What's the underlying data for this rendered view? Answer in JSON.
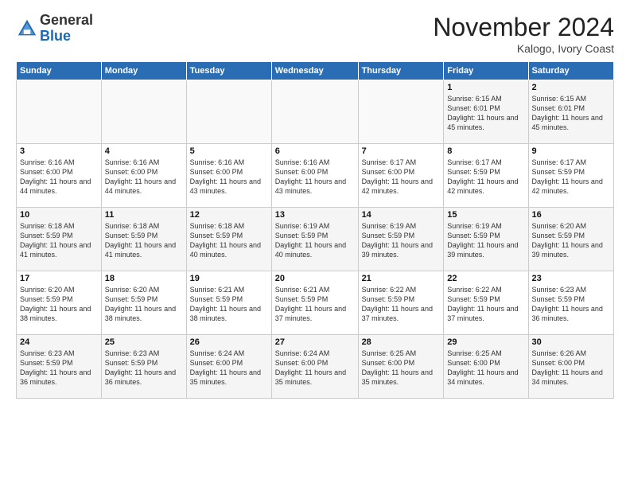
{
  "logo": {
    "general": "General",
    "blue": "Blue"
  },
  "header": {
    "title": "November 2024",
    "location": "Kalogo, Ivory Coast"
  },
  "weekdays": [
    "Sunday",
    "Monday",
    "Tuesday",
    "Wednesday",
    "Thursday",
    "Friday",
    "Saturday"
  ],
  "weeks": [
    [
      {
        "day": "",
        "info": ""
      },
      {
        "day": "",
        "info": ""
      },
      {
        "day": "",
        "info": ""
      },
      {
        "day": "",
        "info": ""
      },
      {
        "day": "",
        "info": ""
      },
      {
        "day": "1",
        "info": "Sunrise: 6:15 AM\nSunset: 6:01 PM\nDaylight: 11 hours and 45 minutes."
      },
      {
        "day": "2",
        "info": "Sunrise: 6:15 AM\nSunset: 6:01 PM\nDaylight: 11 hours and 45 minutes."
      }
    ],
    [
      {
        "day": "3",
        "info": "Sunrise: 6:16 AM\nSunset: 6:00 PM\nDaylight: 11 hours and 44 minutes."
      },
      {
        "day": "4",
        "info": "Sunrise: 6:16 AM\nSunset: 6:00 PM\nDaylight: 11 hours and 44 minutes."
      },
      {
        "day": "5",
        "info": "Sunrise: 6:16 AM\nSunset: 6:00 PM\nDaylight: 11 hours and 43 minutes."
      },
      {
        "day": "6",
        "info": "Sunrise: 6:16 AM\nSunset: 6:00 PM\nDaylight: 11 hours and 43 minutes."
      },
      {
        "day": "7",
        "info": "Sunrise: 6:17 AM\nSunset: 6:00 PM\nDaylight: 11 hours and 42 minutes."
      },
      {
        "day": "8",
        "info": "Sunrise: 6:17 AM\nSunset: 5:59 PM\nDaylight: 11 hours and 42 minutes."
      },
      {
        "day": "9",
        "info": "Sunrise: 6:17 AM\nSunset: 5:59 PM\nDaylight: 11 hours and 42 minutes."
      }
    ],
    [
      {
        "day": "10",
        "info": "Sunrise: 6:18 AM\nSunset: 5:59 PM\nDaylight: 11 hours and 41 minutes."
      },
      {
        "day": "11",
        "info": "Sunrise: 6:18 AM\nSunset: 5:59 PM\nDaylight: 11 hours and 41 minutes."
      },
      {
        "day": "12",
        "info": "Sunrise: 6:18 AM\nSunset: 5:59 PM\nDaylight: 11 hours and 40 minutes."
      },
      {
        "day": "13",
        "info": "Sunrise: 6:19 AM\nSunset: 5:59 PM\nDaylight: 11 hours and 40 minutes."
      },
      {
        "day": "14",
        "info": "Sunrise: 6:19 AM\nSunset: 5:59 PM\nDaylight: 11 hours and 39 minutes."
      },
      {
        "day": "15",
        "info": "Sunrise: 6:19 AM\nSunset: 5:59 PM\nDaylight: 11 hours and 39 minutes."
      },
      {
        "day": "16",
        "info": "Sunrise: 6:20 AM\nSunset: 5:59 PM\nDaylight: 11 hours and 39 minutes."
      }
    ],
    [
      {
        "day": "17",
        "info": "Sunrise: 6:20 AM\nSunset: 5:59 PM\nDaylight: 11 hours and 38 minutes."
      },
      {
        "day": "18",
        "info": "Sunrise: 6:20 AM\nSunset: 5:59 PM\nDaylight: 11 hours and 38 minutes."
      },
      {
        "day": "19",
        "info": "Sunrise: 6:21 AM\nSunset: 5:59 PM\nDaylight: 11 hours and 38 minutes."
      },
      {
        "day": "20",
        "info": "Sunrise: 6:21 AM\nSunset: 5:59 PM\nDaylight: 11 hours and 37 minutes."
      },
      {
        "day": "21",
        "info": "Sunrise: 6:22 AM\nSunset: 5:59 PM\nDaylight: 11 hours and 37 minutes."
      },
      {
        "day": "22",
        "info": "Sunrise: 6:22 AM\nSunset: 5:59 PM\nDaylight: 11 hours and 37 minutes."
      },
      {
        "day": "23",
        "info": "Sunrise: 6:23 AM\nSunset: 5:59 PM\nDaylight: 11 hours and 36 minutes."
      }
    ],
    [
      {
        "day": "24",
        "info": "Sunrise: 6:23 AM\nSunset: 5:59 PM\nDaylight: 11 hours and 36 minutes."
      },
      {
        "day": "25",
        "info": "Sunrise: 6:23 AM\nSunset: 5:59 PM\nDaylight: 11 hours and 36 minutes."
      },
      {
        "day": "26",
        "info": "Sunrise: 6:24 AM\nSunset: 6:00 PM\nDaylight: 11 hours and 35 minutes."
      },
      {
        "day": "27",
        "info": "Sunrise: 6:24 AM\nSunset: 6:00 PM\nDaylight: 11 hours and 35 minutes."
      },
      {
        "day": "28",
        "info": "Sunrise: 6:25 AM\nSunset: 6:00 PM\nDaylight: 11 hours and 35 minutes."
      },
      {
        "day": "29",
        "info": "Sunrise: 6:25 AM\nSunset: 6:00 PM\nDaylight: 11 hours and 34 minutes."
      },
      {
        "day": "30",
        "info": "Sunrise: 6:26 AM\nSunset: 6:00 PM\nDaylight: 11 hours and 34 minutes."
      }
    ]
  ]
}
